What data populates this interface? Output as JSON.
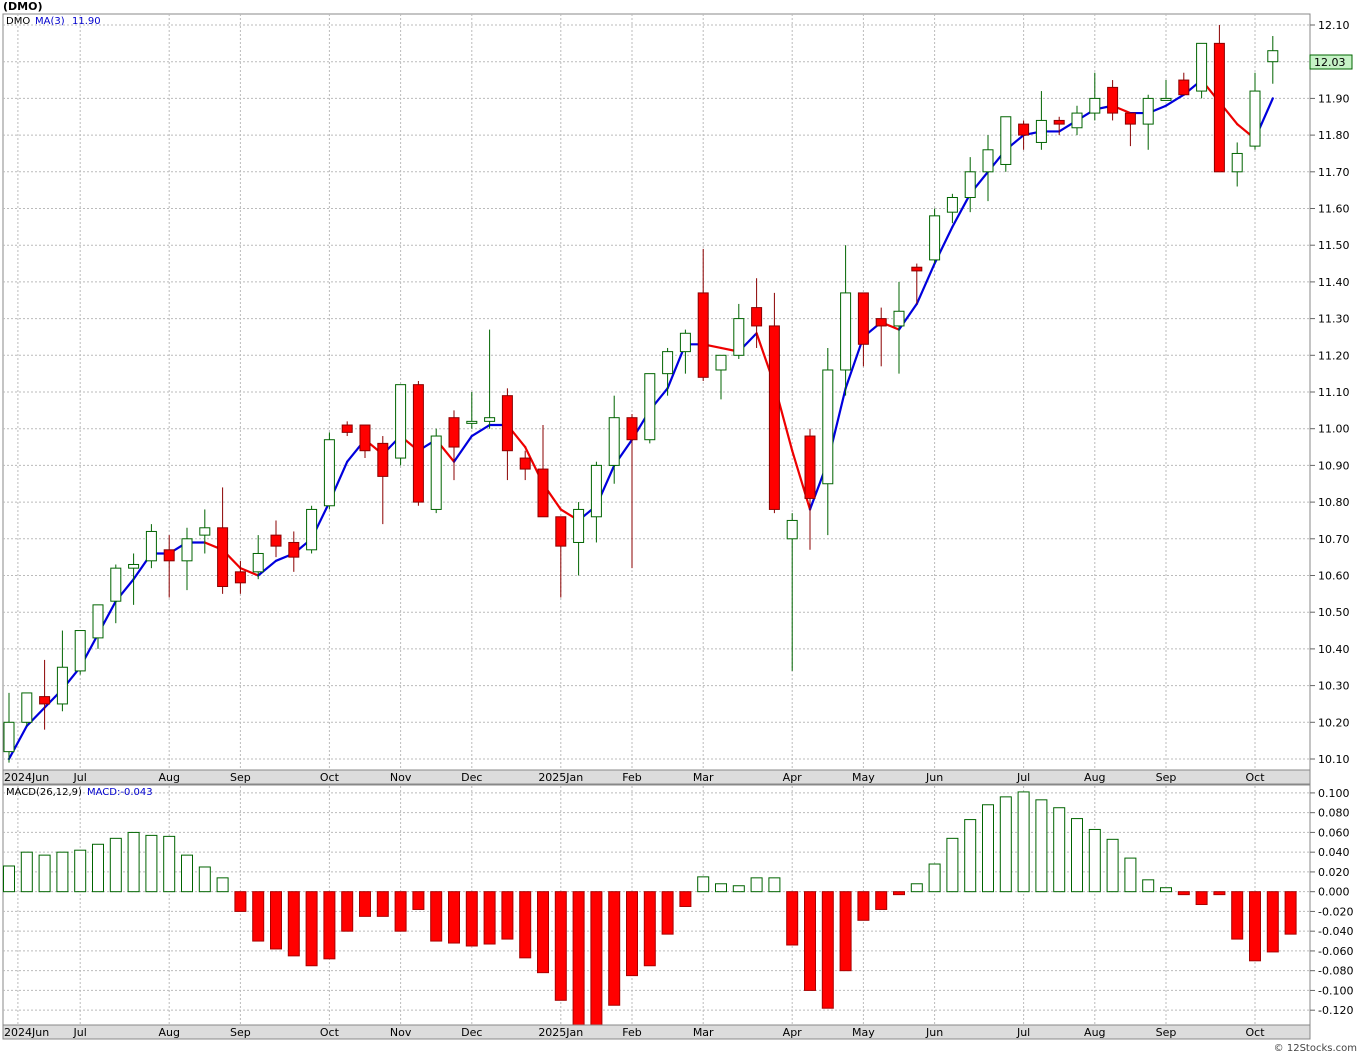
{
  "ticker_title": "(DMO)",
  "price_panel": {
    "symbol_label": "DMO",
    "ma_label": "MA(3)",
    "ma_value": "11.90",
    "last_price": "12.03",
    "last_price_bg": "#c6f2c6"
  },
  "macd_panel": {
    "label": "MACD(26,12,9)",
    "value_label": "MACD:-0.043"
  },
  "footer": "© 12Stocks.com",
  "colors": {
    "up_body": "#ffffff",
    "up_stroke": "#006400",
    "down_body": "#ff0000",
    "down_stroke": "#8b0000",
    "ma_up": "#0000dd",
    "ma_down": "#ee0000",
    "macd_pos_stroke": "#006400",
    "macd_neg_fill": "#ff0000"
  },
  "chart_data": [
    {
      "type": "candlestick",
      "ylim": [
        10.07,
        12.13
      ],
      "y_ticks": [
        "10.10",
        "10.20",
        "10.30",
        "10.40",
        "10.50",
        "10.60",
        "10.70",
        "10.80",
        "10.90",
        "11.00",
        "11.10",
        "11.20",
        "11.30",
        "11.40",
        "11.50",
        "11.60",
        "11.70",
        "11.80",
        "11.90",
        "12.00",
        "12.10"
      ],
      "x_tick_labels": [
        {
          "i": 0.5,
          "label": "2024Jun"
        },
        {
          "i": 4,
          "label": "Jul"
        },
        {
          "i": 9,
          "label": "Aug"
        },
        {
          "i": 13,
          "label": "Sep"
        },
        {
          "i": 18,
          "label": "Oct"
        },
        {
          "i": 22,
          "label": "Nov"
        },
        {
          "i": 26,
          "label": "Dec"
        },
        {
          "i": 31,
          "label": "2025Jan"
        },
        {
          "i": 35,
          "label": "Feb"
        },
        {
          "i": 39,
          "label": "Mar"
        },
        {
          "i": 44,
          "label": "Apr"
        },
        {
          "i": 48,
          "label": "May"
        },
        {
          "i": 52,
          "label": "Jun"
        },
        {
          "i": 57,
          "label": "Jul"
        },
        {
          "i": 61,
          "label": "Aug"
        },
        {
          "i": 65,
          "label": "Sep"
        },
        {
          "i": 70,
          "label": "Oct"
        }
      ],
      "candles": [
        {
          "o": 10.12,
          "h": 10.28,
          "l": 10.09,
          "c": 10.2
        },
        {
          "o": 10.2,
          "h": 10.28,
          "l": 10.19,
          "c": 10.28
        },
        {
          "o": 10.27,
          "h": 10.37,
          "l": 10.18,
          "c": 10.25
        },
        {
          "o": 10.25,
          "h": 10.45,
          "l": 10.23,
          "c": 10.35
        },
        {
          "o": 10.34,
          "h": 10.45,
          "l": 10.33,
          "c": 10.45
        },
        {
          "o": 10.43,
          "h": 10.52,
          "l": 10.4,
          "c": 10.52
        },
        {
          "o": 10.53,
          "h": 10.63,
          "l": 10.47,
          "c": 10.62
        },
        {
          "o": 10.62,
          "h": 10.66,
          "l": 10.52,
          "c": 10.63
        },
        {
          "o": 10.64,
          "h": 10.74,
          "l": 10.62,
          "c": 10.72
        },
        {
          "o": 10.67,
          "h": 10.71,
          "l": 10.54,
          "c": 10.64
        },
        {
          "o": 10.64,
          "h": 10.73,
          "l": 10.56,
          "c": 10.7
        },
        {
          "o": 10.71,
          "h": 10.78,
          "l": 10.66,
          "c": 10.73
        },
        {
          "o": 10.73,
          "h": 10.84,
          "l": 10.55,
          "c": 10.57
        },
        {
          "o": 10.61,
          "h": 10.64,
          "l": 10.55,
          "c": 10.58
        },
        {
          "o": 10.61,
          "h": 10.71,
          "l": 10.59,
          "c": 10.66
        },
        {
          "o": 10.71,
          "h": 10.75,
          "l": 10.65,
          "c": 10.68
        },
        {
          "o": 10.69,
          "h": 10.72,
          "l": 10.61,
          "c": 10.65
        },
        {
          "o": 10.67,
          "h": 10.79,
          "l": 10.66,
          "c": 10.78
        },
        {
          "o": 10.79,
          "h": 10.99,
          "l": 10.78,
          "c": 10.97
        },
        {
          "o": 11.01,
          "h": 11.02,
          "l": 10.98,
          "c": 10.99
        },
        {
          "o": 11.01,
          "h": 11.01,
          "l": 10.92,
          "c": 10.94
        },
        {
          "o": 10.96,
          "h": 10.98,
          "l": 10.74,
          "c": 10.87
        },
        {
          "o": 10.92,
          "h": 11.12,
          "l": 10.9,
          "c": 11.12
        },
        {
          "o": 11.12,
          "h": 11.13,
          "l": 10.79,
          "c": 10.8
        },
        {
          "o": 10.78,
          "h": 11.0,
          "l": 10.77,
          "c": 10.98
        },
        {
          "o": 11.03,
          "h": 11.05,
          "l": 10.86,
          "c": 10.95
        },
        {
          "o": 11.02,
          "h": 11.1,
          "l": 11.0,
          "c": 11.02
        },
        {
          "o": 11.02,
          "h": 11.27,
          "l": 11.0,
          "c": 11.03
        },
        {
          "o": 11.09,
          "h": 11.11,
          "l": 10.86,
          "c": 10.94
        },
        {
          "o": 10.92,
          "h": 10.94,
          "l": 10.86,
          "c": 10.89
        },
        {
          "o": 10.89,
          "h": 11.01,
          "l": 10.76,
          "c": 10.76
        },
        {
          "o": 10.76,
          "h": 10.76,
          "l": 10.54,
          "c": 10.68
        },
        {
          "o": 10.69,
          "h": 10.8,
          "l": 10.6,
          "c": 10.78
        },
        {
          "o": 10.76,
          "h": 10.91,
          "l": 10.69,
          "c": 10.9
        },
        {
          "o": 10.9,
          "h": 11.09,
          "l": 10.85,
          "c": 11.03
        },
        {
          "o": 11.03,
          "h": 11.04,
          "l": 10.62,
          "c": 10.97
        },
        {
          "o": 10.97,
          "h": 11.15,
          "l": 10.96,
          "c": 11.15
        },
        {
          "o": 11.15,
          "h": 11.22,
          "l": 11.09,
          "c": 11.21
        },
        {
          "o": 11.21,
          "h": 11.27,
          "l": 11.15,
          "c": 11.26
        },
        {
          "o": 11.37,
          "h": 11.49,
          "l": 11.13,
          "c": 11.14
        },
        {
          "o": 11.16,
          "h": 11.2,
          "l": 11.08,
          "c": 11.2
        },
        {
          "o": 11.2,
          "h": 11.34,
          "l": 11.19,
          "c": 11.3
        },
        {
          "o": 11.33,
          "h": 11.41,
          "l": 11.22,
          "c": 11.28
        },
        {
          "o": 11.28,
          "h": 11.37,
          "l": 10.77,
          "c": 10.78
        },
        {
          "o": 10.7,
          "h": 10.77,
          "l": 10.34,
          "c": 10.75
        },
        {
          "o": 10.98,
          "h": 11.0,
          "l": 10.67,
          "c": 10.81
        },
        {
          "o": 10.85,
          "h": 11.22,
          "l": 10.71,
          "c": 11.16
        },
        {
          "o": 11.16,
          "h": 11.5,
          "l": 11.09,
          "c": 11.37
        },
        {
          "o": 11.37,
          "h": 11.37,
          "l": 11.17,
          "c": 11.23
        },
        {
          "o": 11.3,
          "h": 11.33,
          "l": 11.17,
          "c": 11.28
        },
        {
          "o": 11.28,
          "h": 11.4,
          "l": 11.15,
          "c": 11.32
        },
        {
          "o": 11.44,
          "h": 11.45,
          "l": 11.34,
          "c": 11.43
        },
        {
          "o": 11.46,
          "h": 11.6,
          "l": 11.45,
          "c": 11.58
        },
        {
          "o": 11.59,
          "h": 11.64,
          "l": 11.56,
          "c": 11.63
        },
        {
          "o": 11.63,
          "h": 11.74,
          "l": 11.59,
          "c": 11.7
        },
        {
          "o": 11.7,
          "h": 11.8,
          "l": 11.62,
          "c": 11.76
        },
        {
          "o": 11.72,
          "h": 11.85,
          "l": 11.7,
          "c": 11.85
        },
        {
          "o": 11.83,
          "h": 11.84,
          "l": 11.76,
          "c": 11.8
        },
        {
          "o": 11.78,
          "h": 11.92,
          "l": 11.76,
          "c": 11.84
        },
        {
          "o": 11.84,
          "h": 11.85,
          "l": 11.8,
          "c": 11.83
        },
        {
          "o": 11.82,
          "h": 11.88,
          "l": 11.8,
          "c": 11.86
        },
        {
          "o": 11.86,
          "h": 11.97,
          "l": 11.84,
          "c": 11.9
        },
        {
          "o": 11.93,
          "h": 11.95,
          "l": 11.84,
          "c": 11.86
        },
        {
          "o": 11.86,
          "h": 11.86,
          "l": 11.77,
          "c": 11.83
        },
        {
          "o": 11.83,
          "h": 11.91,
          "l": 11.76,
          "c": 11.9
        },
        {
          "o": 11.9,
          "h": 11.95,
          "l": 11.9,
          "c": 11.9
        },
        {
          "o": 11.95,
          "h": 11.97,
          "l": 11.92,
          "c": 11.91
        },
        {
          "o": 11.92,
          "h": 12.05,
          "l": 11.9,
          "c": 12.05
        },
        {
          "o": 12.05,
          "h": 12.1,
          "l": 11.7,
          "c": 11.7
        },
        {
          "o": 11.7,
          "h": 11.78,
          "l": 11.66,
          "c": 11.75
        },
        {
          "o": 11.77,
          "h": 11.97,
          "l": 11.76,
          "c": 11.92
        },
        {
          "o": 12.0,
          "h": 12.07,
          "l": 11.94,
          "c": 12.03
        }
      ],
      "ma3": [
        10.1,
        10.19,
        10.24,
        10.29,
        10.35,
        10.44,
        10.53,
        10.59,
        10.66,
        10.66,
        10.69,
        10.69,
        10.67,
        10.62,
        10.6,
        10.64,
        10.66,
        10.7,
        10.8,
        10.91,
        10.97,
        10.93,
        10.98,
        10.94,
        10.97,
        10.91,
        10.98,
        11.01,
        11.01,
        10.95,
        10.85,
        10.78,
        10.75,
        10.79,
        10.9,
        10.97,
        11.05,
        11.11,
        11.23,
        11.23,
        11.22,
        11.21,
        11.26,
        11.12,
        10.94,
        10.78,
        10.91,
        11.11,
        11.25,
        11.29,
        11.27,
        11.34,
        11.45,
        11.55,
        11.64,
        11.7,
        11.76,
        11.8,
        11.81,
        11.81,
        11.84,
        11.87,
        11.88,
        11.86,
        11.86,
        11.88,
        11.91,
        11.95,
        11.89,
        11.83,
        11.79,
        11.9
      ]
    },
    {
      "type": "bar",
      "name": "MACD(26,12,9)",
      "ylim": [
        -0.135,
        0.107
      ],
      "y_ticks": [
        "0.100",
        "0.080",
        "0.060",
        "0.040",
        "0.020",
        "0.000",
        "-0.020",
        "-0.040",
        "-0.060",
        "-0.080",
        "-0.100",
        "-0.120"
      ],
      "values": [
        0.026,
        0.04,
        0.037,
        0.04,
        0.042,
        0.048,
        0.054,
        0.06,
        0.057,
        0.056,
        0.037,
        0.025,
        0.014,
        -0.02,
        -0.05,
        -0.058,
        -0.065,
        -0.075,
        -0.068,
        -0.04,
        -0.025,
        -0.025,
        -0.04,
        -0.018,
        -0.05,
        -0.052,
        -0.055,
        -0.053,
        -0.048,
        -0.067,
        -0.082,
        -0.11,
        -0.135,
        -0.135,
        -0.115,
        -0.085,
        -0.075,
        -0.043,
        -0.015,
        0.015,
        0.008,
        0.006,
        0.014,
        0.014,
        -0.054,
        -0.1,
        -0.118,
        -0.08,
        -0.029,
        -0.018,
        -0.003,
        0.008,
        0.028,
        0.054,
        0.073,
        0.088,
        0.096,
        0.101,
        0.093,
        0.085,
        0.074,
        0.063,
        0.053,
        0.034,
        0.012,
        0.004,
        -0.003,
        -0.013,
        -0.003,
        -0.048,
        -0.07,
        -0.061,
        -0.043
      ]
    }
  ]
}
